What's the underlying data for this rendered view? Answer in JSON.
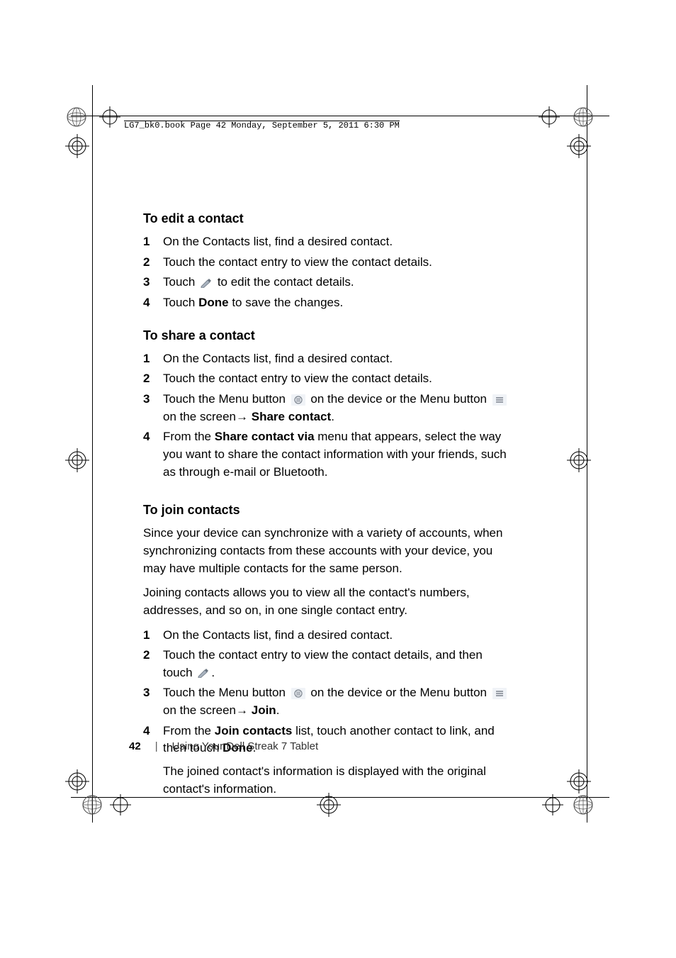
{
  "header": "LG7_bk0.book  Page 42  Monday, September 5, 2011  6:30 PM",
  "sections": {
    "edit": {
      "title": "To edit a contact",
      "steps": [
        {
          "n": "1",
          "text": "On the Contacts list, find a desired contact."
        },
        {
          "n": "2",
          "text": "Touch the contact entry to view the contact details."
        },
        {
          "n": "3",
          "pre": "Touch ",
          "post": " to edit the contact details."
        },
        {
          "n": "4",
          "pre": "Touch ",
          "bold": "Done",
          "post": " to save the changes."
        }
      ]
    },
    "share": {
      "title": "To share a contact",
      "steps": [
        {
          "n": "1",
          "text": "On the Contacts list, find a desired contact."
        },
        {
          "n": "2",
          "text": "Touch the contact entry to view the contact details."
        },
        {
          "n": "3",
          "part1": "Touch the Menu button ",
          "part2": " on the device or the Menu button ",
          "part3": " on the screen",
          "arrow": "→ ",
          "bold": "Share contact",
          "tail": "."
        },
        {
          "n": "4",
          "pre": "From the ",
          "bold": "Share contact via",
          "post": " menu that appears, select the way you want to share the contact information with your friends, such as through e-mail or Bluetooth."
        }
      ]
    },
    "join": {
      "title": "To join contacts",
      "intro1": "Since your device can synchronize with a variety of accounts, when synchronizing contacts from these accounts with your device, you may have multiple contacts for the same person.",
      "intro2": "Joining contacts allows you to view all the contact's numbers, addresses, and so on, in one single contact entry.",
      "steps": [
        {
          "n": "1",
          "text": "On the Contacts list, find a desired contact."
        },
        {
          "n": "2",
          "pre": "Touch the contact entry to view the contact details, and then touch ",
          "post": "."
        },
        {
          "n": "3",
          "part1": "Touch the Menu button ",
          "part2": " on the device or the Menu button ",
          "part3": " on the screen",
          "arrow": "→ ",
          "bold": "Join",
          "tail": "."
        },
        {
          "n": "4",
          "pre": "From the ",
          "bold": "Join contacts",
          "mid": " list, touch another contact to link, and then touch ",
          "bold2": "Done",
          "tail": ".",
          "after": "The joined contact's information is displayed with the original contact's information."
        }
      ]
    }
  },
  "footer": {
    "page": "42",
    "title": "Using Your Dell Streak 7 Tablet"
  },
  "icons": {
    "pencil": "pencil-icon",
    "menu_hw": "menu-hardware-icon",
    "menu_sw": "menu-software-icon"
  }
}
